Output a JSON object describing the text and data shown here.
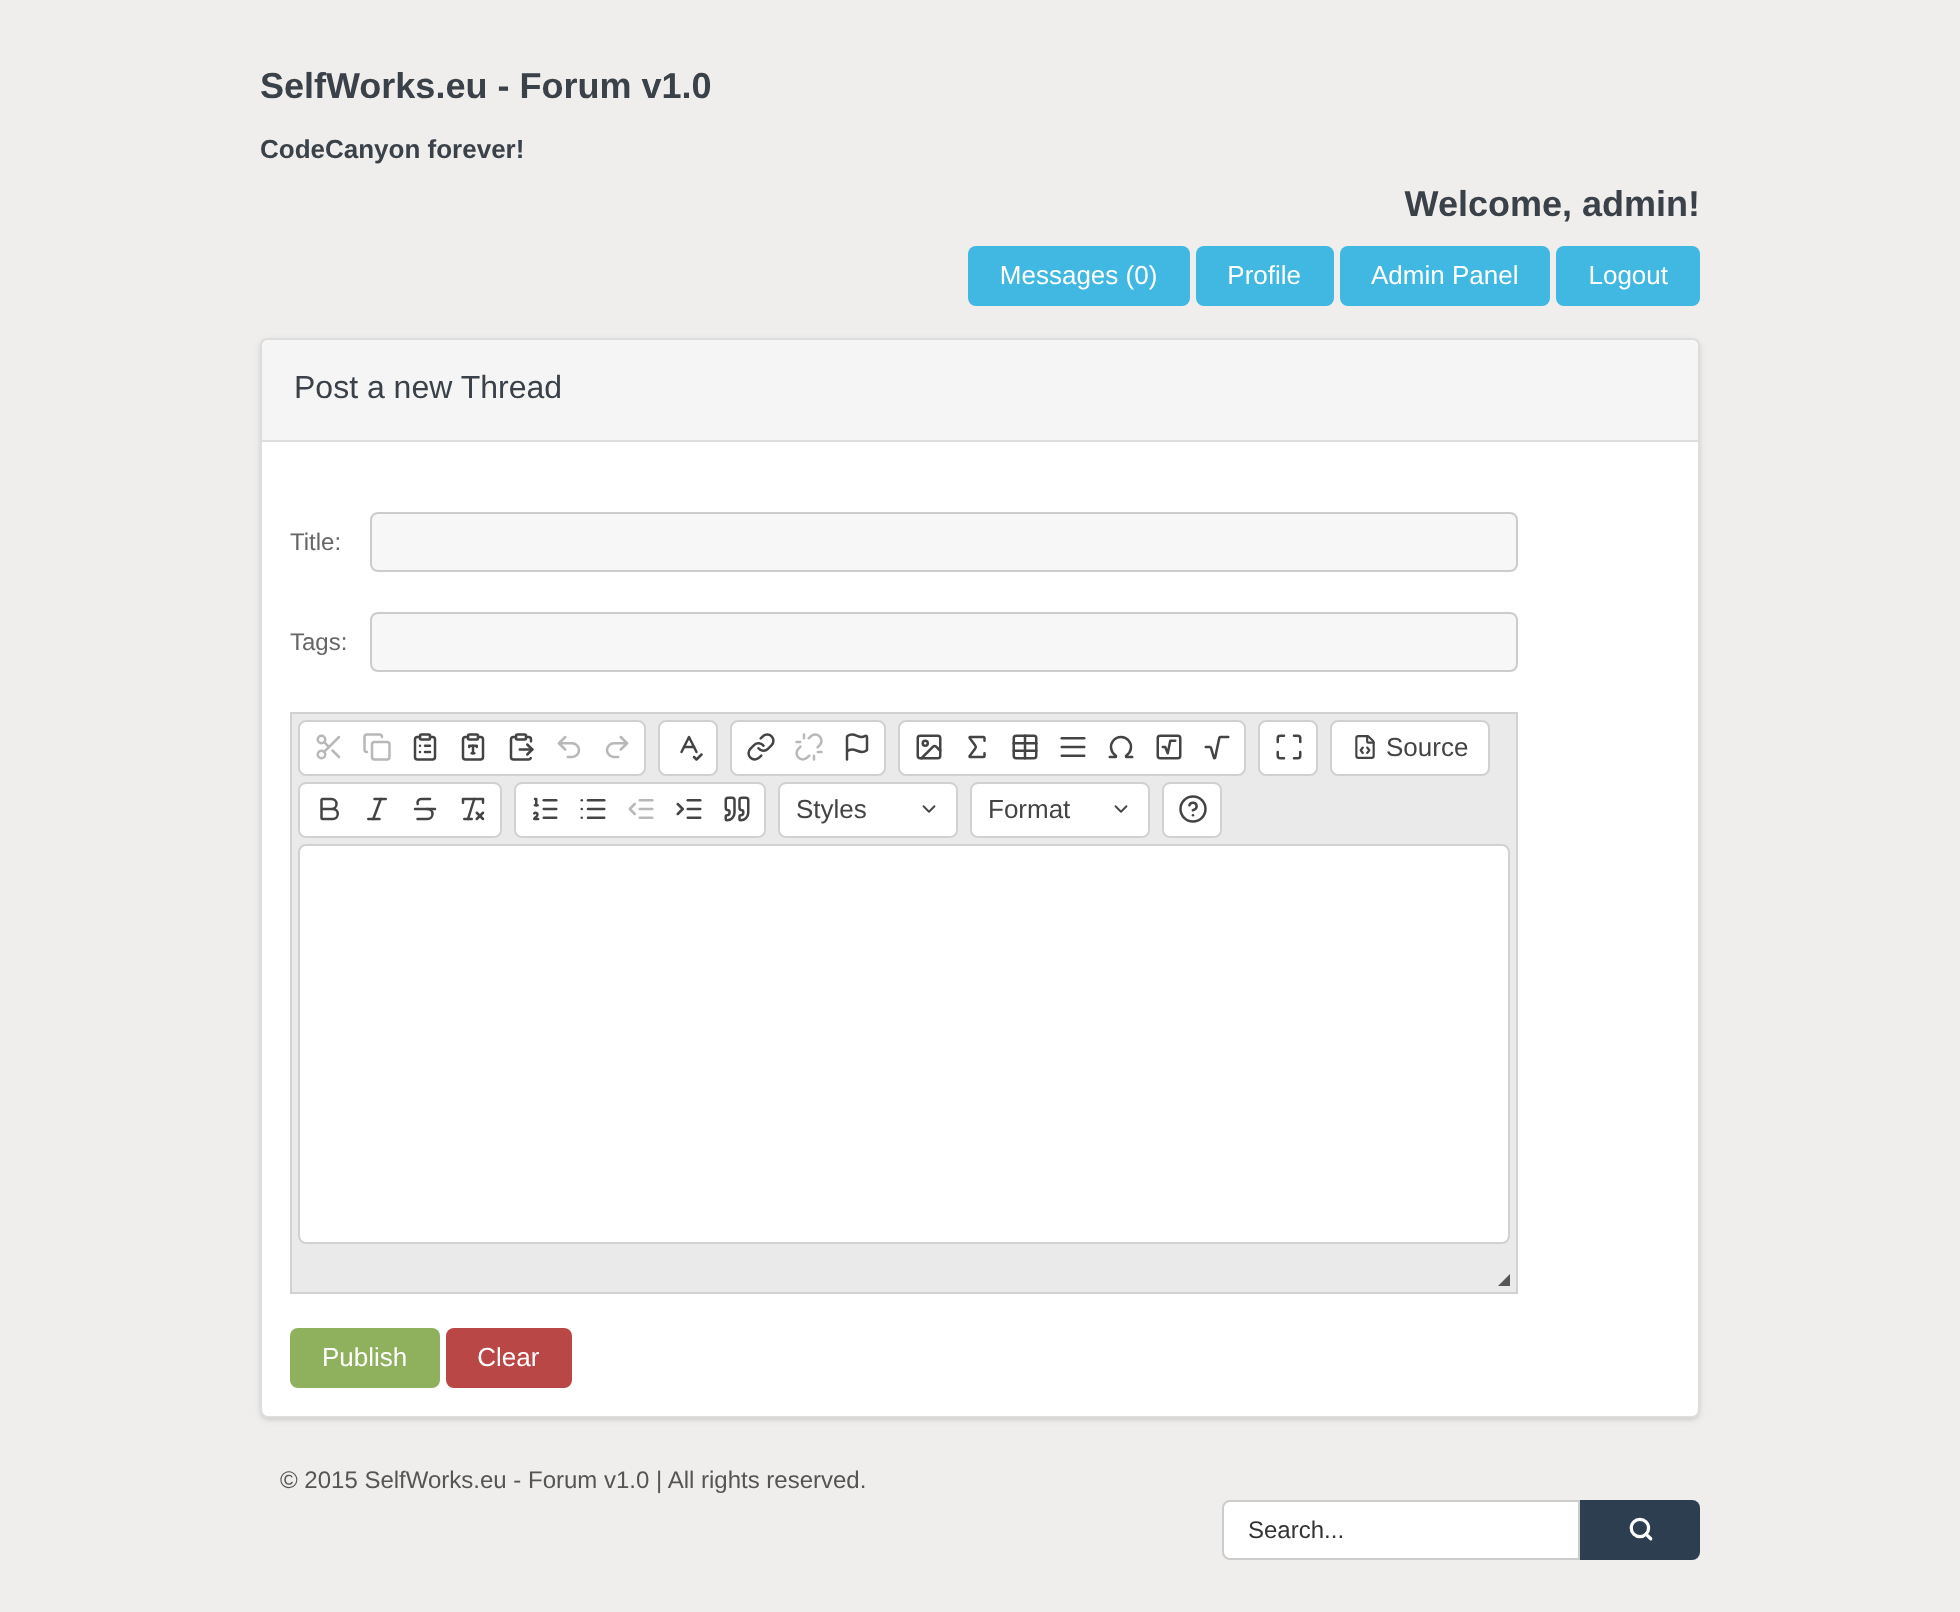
{
  "site": {
    "title": "SelfWorks.eu - Forum v1.0",
    "tagline": "CodeCanyon forever!",
    "welcome": "Welcome, admin!"
  },
  "nav": [
    "Messages (0)",
    "Profile",
    "Admin Panel",
    "Logout"
  ],
  "panel": {
    "title": "Post a new Thread"
  },
  "fields": [
    {
      "label": "Title:"
    },
    {
      "label": "Tags:"
    }
  ],
  "toolbar": [
    [
      [
        {
          "kind": "cut",
          "disabled": true
        },
        {
          "kind": "copy",
          "disabled": true
        },
        {
          "kind": "paste",
          "disabled": false
        },
        {
          "kind": "paste-text",
          "disabled": false
        },
        {
          "kind": "paste-word",
          "disabled": false
        },
        {
          "kind": "undo",
          "disabled": true
        },
        {
          "kind": "redo",
          "disabled": true
        }
      ],
      [
        {
          "kind": "spellcheck",
          "disabled": false
        }
      ],
      [
        {
          "kind": "link",
          "disabled": false
        },
        {
          "kind": "unlink",
          "disabled": true
        },
        {
          "kind": "anchor",
          "disabled": false
        }
      ],
      [
        {
          "kind": "image",
          "disabled": false
        },
        {
          "kind": "sigma",
          "disabled": false
        },
        {
          "kind": "table",
          "disabled": false
        },
        {
          "kind": "rule",
          "disabled": false
        },
        {
          "kind": "omega",
          "disabled": false
        },
        {
          "kind": "radical",
          "disabled": false
        },
        {
          "kind": "sqrt",
          "disabled": false
        }
      ],
      [
        {
          "kind": "maximize",
          "disabled": false
        }
      ],
      [
        {
          "kind": "source",
          "disabled": false,
          "label": "Source"
        }
      ]
    ],
    [
      [
        {
          "kind": "bold",
          "disabled": false
        },
        {
          "kind": "italic",
          "disabled": false
        },
        {
          "kind": "strike",
          "disabled": false
        },
        {
          "kind": "clear-format",
          "disabled": false
        }
      ],
      [
        {
          "kind": "numbered",
          "disabled": false
        },
        {
          "kind": "bulleted",
          "disabled": false
        },
        {
          "kind": "outdent",
          "disabled": true
        },
        {
          "kind": "indent",
          "disabled": false
        },
        {
          "kind": "quote",
          "disabled": false
        }
      ],
      [
        {
          "kind": "dropdown",
          "label": "Styles",
          "disabled": false
        }
      ],
      [
        {
          "kind": "dropdown",
          "label": "Format",
          "disabled": false
        }
      ],
      [
        {
          "kind": "help",
          "disabled": false
        }
      ]
    ]
  ],
  "actions": [
    {
      "label": "Publish",
      "kind": "primary"
    },
    {
      "label": "Clear",
      "kind": "danger"
    }
  ],
  "footer": {
    "copyright": "© 2015 SelfWorks.eu - Forum v1.0 | All rights reserved.",
    "search_placeholder": "Search..."
  }
}
